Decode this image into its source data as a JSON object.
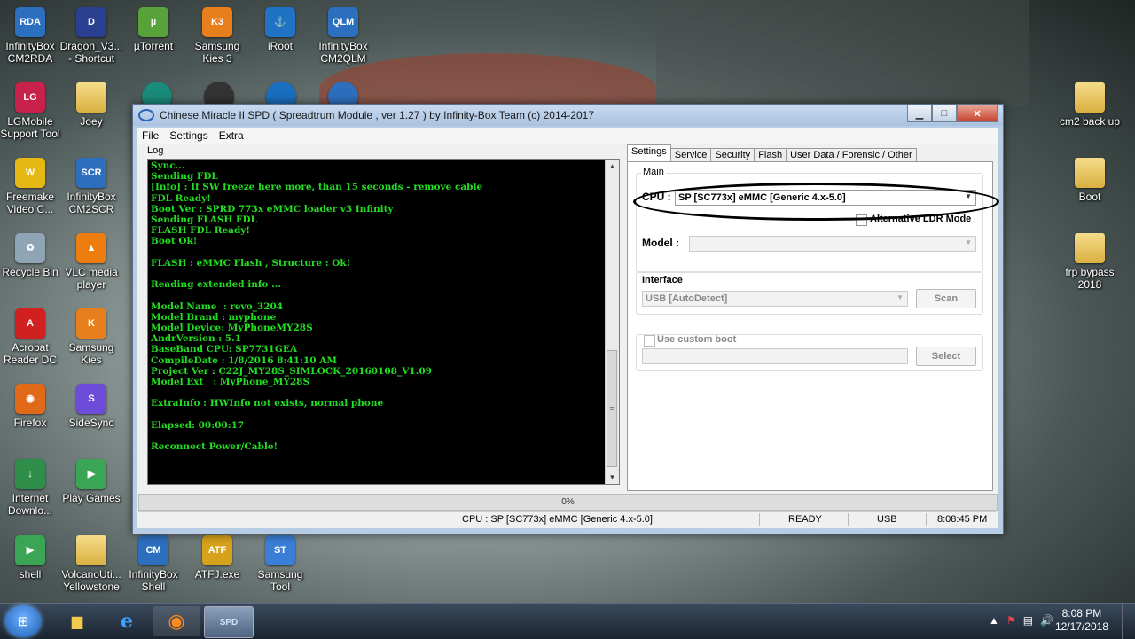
{
  "desktop": {
    "icons": [
      {
        "label": "InfinityBox\nCM2RDA",
        "icon": "infinitybox-icon",
        "badge": "RDA",
        "color": "#2d6fbf"
      },
      {
        "label": "Dragon_V3...\n- Shortcut",
        "icon": "dragon-icon",
        "badge": "D",
        "color": "#2a3f8f"
      },
      {
        "label": "µTorrent",
        "icon": "utorrent-icon",
        "badge": "µ",
        "color": "#58a23a"
      },
      {
        "label": "Samsung\nKies 3",
        "icon": "samsung-kies-icon",
        "badge": "K3",
        "color": "#e7801c"
      },
      {
        "label": "iRoot",
        "icon": "iroot-icon",
        "badge": "⚓",
        "color": "#1f72c4"
      },
      {
        "label": "InfinityBox\nCM2QLM",
        "icon": "infinitybox-icon",
        "badge": "QLM",
        "color": "#2d6fbf"
      },
      {
        "label": "LGMobile\nSupport Tool",
        "icon": "lgmobile-icon",
        "badge": "LG",
        "color": "#c8224c"
      },
      {
        "label": "Joey",
        "icon": "folder-icon",
        "badge": "",
        "color": "#e0b84a"
      },
      {
        "label": "Freemake\nVideo C...",
        "icon": "freemake-icon",
        "badge": "W",
        "color": "#e6b814"
      },
      {
        "label": "InfinityBox\nCM2SCR",
        "icon": "infinitybox-icon",
        "badge": "SCR",
        "color": "#2d6fbf"
      },
      {
        "label": "Recycle Bin",
        "icon": "recycle-bin-icon",
        "badge": "♻",
        "color": "#8fa4b4"
      },
      {
        "label": "VLC media\nplayer",
        "icon": "vlc-icon",
        "badge": "▲",
        "color": "#ee7d10"
      },
      {
        "label": "Acrobat\nReader DC",
        "icon": "acrobat-icon",
        "badge": "A",
        "color": "#d0201f"
      },
      {
        "label": "Samsung\nKies",
        "icon": "samsung-kies-icon",
        "badge": "K",
        "color": "#e7801c"
      },
      {
        "label": "Firefox",
        "icon": "firefox-icon",
        "badge": "◉",
        "color": "#e06a17"
      },
      {
        "label": "SideSync",
        "icon": "sidesync-icon",
        "badge": "S",
        "color": "#6c4cd8"
      },
      {
        "label": "Internet\nDownlo...",
        "icon": "idm-icon",
        "badge": "↓",
        "color": "#2f8f4a"
      },
      {
        "label": "Play Games",
        "icon": "play-games-icon",
        "badge": "▶",
        "color": "#3aa655"
      },
      {
        "label": "shell",
        "icon": "shell-icon",
        "badge": "▶",
        "color": "#3aa655"
      },
      {
        "label": "VolcanoUti...\nYellowstone",
        "icon": "folder-icon",
        "badge": "",
        "color": "#e0b84a"
      },
      {
        "label": "InfinityBox\nShell",
        "icon": "infinitybox-icon",
        "badge": "CM",
        "color": "#2d6fbf"
      },
      {
        "label": "ATFJ.exe",
        "icon": "atf-icon",
        "badge": "ATF",
        "color": "#d6a21c"
      },
      {
        "label": "Samsung\nTool",
        "icon": "samsung-tool-icon",
        "badge": "ST",
        "color": "#3b7ed8"
      },
      {
        "label": "cm2 back up",
        "icon": "folder-icon",
        "badge": "",
        "color": "#e0b84a"
      },
      {
        "label": "Boot",
        "icon": "folder-icon",
        "badge": "",
        "color": "#e0b84a"
      },
      {
        "label": "frp bypass\n2018",
        "icon": "folder-icon",
        "badge": "",
        "color": "#e0b84a"
      }
    ],
    "partial_icons": [
      {
        "icon": "app-icon",
        "color": "#1a8a7a"
      },
      {
        "icon": "app-icon",
        "color": "#333"
      },
      {
        "icon": "app-icon",
        "color": "#1a6fbf"
      },
      {
        "icon": "app-icon",
        "color": "#2d6fbf"
      }
    ]
  },
  "window": {
    "title": "Chinese Miracle II SPD ( Spreadtrum Module , ver 1.27 ) by Infinity-Box Team (c) 2014-2017",
    "menu": [
      "File",
      "Settings",
      "Extra"
    ],
    "log_label": "Log",
    "log_lines": [
      "Sync...",
      "Sending FDL",
      "[Info] : If SW freeze here more, than 15 seconds - remove cable",
      "FDL Ready!",
      "Boot Ver : SPRD 773x eMMC loader v3 Infinity",
      "Sending FLASH FDL",
      "FLASH FDL Ready!",
      "Boot Ok!",
      "",
      "FLASH : eMMC Flash , Structure : Ok!",
      "",
      "Reading extended info ...",
      "",
      "Model Name  : revo_3204",
      "Model Brand : myphone",
      "Model Device: MyPhoneMY28S",
      "AndrVersion : 5.1",
      "BaseBand CPU: SP7731GEA",
      "CompileDate : 1/8/2016 8:41:10 AM",
      "Project Ver : C22J_MY28S_SIMLOCK_20160108_V1.09",
      "Model Ext   : MyPhone_MY28S",
      "",
      "ExtraInfo : HWInfo not exists, normal phone",
      "",
      "Elapsed: 00:00:17",
      "",
      "Reconnect Power/Cable!"
    ],
    "tabs": [
      "Settings",
      "Service",
      "Security",
      "Flash",
      "User Data / Forensic / Other"
    ],
    "settings": {
      "main_group": "Main",
      "cpu_label": "CPU :",
      "cpu_value": "SP [SC773x] eMMC [Generic 4.x-5.0]",
      "alt_ldr_label": "Alternative LDR Mode",
      "model_label": "Model :",
      "model_value": "",
      "interface_label": "Interface",
      "interface_value": "USB [AutoDetect]",
      "scan_label": "Scan",
      "custom_boot_label": "Use custom boot",
      "custom_boot_value": "",
      "select_label": "Select"
    },
    "progress": "0%",
    "status": {
      "cpu": "CPU : SP [SC773x] eMMC [Generic 4.x-5.0]",
      "state": "READY",
      "port": "USB",
      "time": "8:08:45 PM"
    }
  },
  "taskbar": {
    "apps": [
      {
        "name": "windows-explorer",
        "glyph": "📁"
      },
      {
        "name": "internet-explorer",
        "glyph": "e"
      },
      {
        "name": "firefox",
        "glyph": "◉"
      },
      {
        "name": "cm2-spd",
        "glyph": "SPD"
      }
    ],
    "clock_time": "8:08 PM",
    "clock_date": "12/17/2018"
  }
}
